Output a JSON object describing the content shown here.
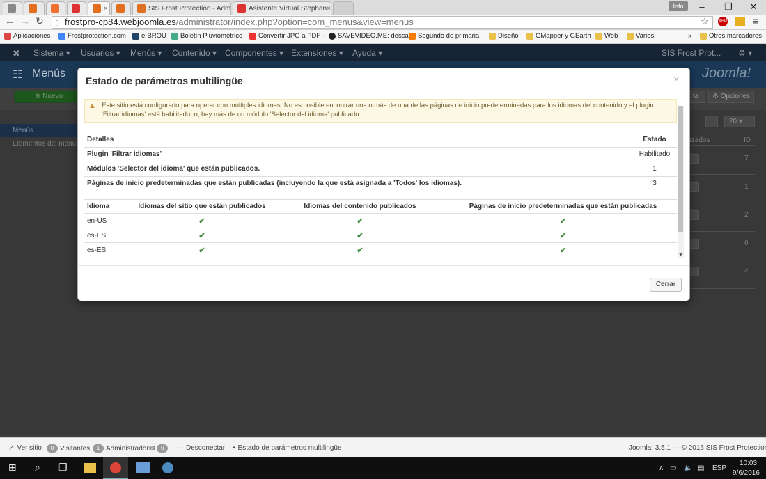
{
  "browser": {
    "tabs": [
      {
        "label": "",
        "color": "#888"
      },
      {
        "label": "",
        "color": "#e07020"
      },
      {
        "label": "",
        "color": "#f07030"
      },
      {
        "label": "",
        "color": "#d33"
      },
      {
        "label": "",
        "color": "#e07020"
      },
      {
        "label": "",
        "color": "#e07020"
      },
      {
        "label": "SIS Frost Protection - Adm",
        "color": "#e07020"
      },
      {
        "label": "Asistente Virtual Stephan",
        "color": "#d33"
      }
    ],
    "info_label": "Info",
    "url_host": "frostpro-cp84.webjoomla.es",
    "url_path": "/administrator/index.php?option=com_menus&view=menus",
    "bookmarks": [
      {
        "label": "Aplicaciones",
        "color": "#d44"
      },
      {
        "label": "Frostprotection.com",
        "color": "#4285f4"
      },
      {
        "label": "e-BROU",
        "color": "#246"
      },
      {
        "label": "Boletín Pluviométrico",
        "color": "#4a8"
      },
      {
        "label": "Convertir JPG a PDF -",
        "color": "#e33"
      },
      {
        "label": "SAVEVIDEO.ME: desca",
        "color": "#222"
      },
      {
        "label": "Segundo de primaria",
        "color": "#f57c00"
      },
      {
        "label": "Diseño",
        "color": "#e8c04a"
      },
      {
        "label": "GMapper y GEarth",
        "color": "#e8c04a"
      },
      {
        "label": "Web",
        "color": "#e8c04a"
      },
      {
        "label": "Varios",
        "color": "#e8c04a"
      }
    ],
    "bookmarks_more": "»",
    "bookmarks_other": "Otros marcadores"
  },
  "joomla": {
    "menu": [
      "Sistema ▾",
      "Usuarios ▾",
      "Menús ▾",
      "Contenido ▾",
      "Componentes ▾",
      "Extensiones ▾",
      "Ayuda ▾"
    ],
    "site_link": "SIS Frost Prot...",
    "gear": "⚙ ▾",
    "page_title": "Menús",
    "logo": "Joomla!",
    "new_button": "Nuevo",
    "options_button": "Opciones",
    "ta_button": "ta",
    "sidebar_active": "Menús",
    "sidebar_item": "Elementos del menú",
    "col_linked": "lazados",
    "col_id": "ID",
    "list_limit": "20",
    "ids": [
      "7",
      "1",
      "2",
      "6",
      "4"
    ]
  },
  "modal": {
    "title": "Estado de parámetros multilingüe",
    "close": "×",
    "warning": "Este sitio está configurado para operar con múltiples idiomas. No es posible encontrar una o más de una de las páginas de inicio predeterminadas para los idiomas del contenido y el plugin 'Filtrar idiomas' está habilitado, o, hay más de un módulo 'Selector del idioma' publicado.",
    "details_header": {
      "label": "Detalles",
      "status": "Estado"
    },
    "details": [
      {
        "label": "Plugin 'Filtrar idiomas'",
        "value": "Habilitado"
      },
      {
        "label": "Módulos 'Selector del idioma' que están publicados.",
        "value": "1"
      },
      {
        "label": "Páginas de inicio predeterminadas que están publicadas (incluyendo la que está asignada a 'Todos' los idiomas).",
        "value": "3"
      }
    ],
    "lang_header": {
      "col1": "Idioma",
      "col2": "Idiomas del sitio que están publicados",
      "col3": "Idiomas del contenido publicados",
      "col4": "Páginas de inicio predeterminadas que están publicadas"
    },
    "languages": [
      {
        "code": "en-US",
        "site": "✔",
        "content": "✔",
        "home": "✔"
      },
      {
        "code": "es-ES",
        "site": "✔",
        "content": "✔",
        "home": "✔"
      },
      {
        "code": "es-ES",
        "site": "✔",
        "content": "✔",
        "home": "✔"
      }
    ],
    "close_button": "Cerrar"
  },
  "statusbar": {
    "view_site": "Ver sitio",
    "visitors_count": "0",
    "visitors": "Visitantes",
    "admins_count": "1",
    "admins": "Administrador",
    "messages_count": "0",
    "logout": "Desconectar",
    "ml_status": "Estado de parámetros multilingüe",
    "version": "Joomla! 3.5.1 — © 2016 SIS Frost Protection"
  },
  "taskbar": {
    "lang": "ESP",
    "time": "10:03",
    "date": "9/6/2016"
  }
}
